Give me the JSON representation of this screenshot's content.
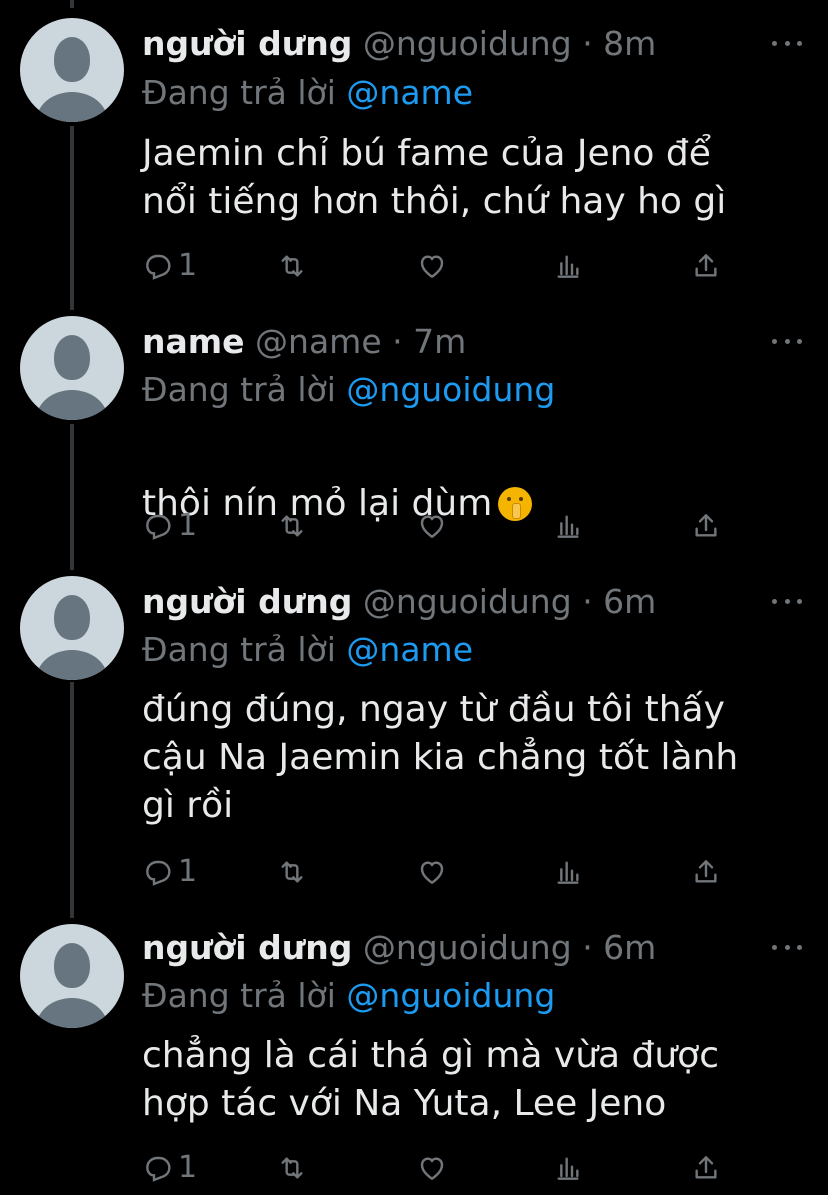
{
  "tweets": [
    {
      "display_name": "người dưng",
      "handle": "@nguoidung",
      "time": "· 8m",
      "reply_prefix": "Đang trả lời",
      "reply_to": "@name",
      "text": "Jaemin chỉ bú fame của Jeno để\nnổi tiếng hơn thôi, chứ hay ho gì",
      "reply_count": "1"
    },
    {
      "display_name": "name",
      "handle": "@name",
      "time": "· 7m",
      "reply_prefix": "Đang trả lời",
      "reply_to": "@nguoidung",
      "text": "thôi nín mỏ lại dùm",
      "emoji": "shushing-face",
      "reply_count": "1"
    },
    {
      "display_name": "người dưng",
      "handle": "@nguoidung",
      "time": "· 6m",
      "reply_prefix": "Đang trả lời",
      "reply_to": "@name",
      "text": "đúng đúng, ngay từ đầu tôi thấy\ncậu Na Jaemin kia chẳng tốt lành\ngì rồi",
      "reply_count": "1"
    },
    {
      "display_name": "người dưng",
      "handle": "@nguoidung",
      "time": "· 6m",
      "reply_prefix": "Đang trả lời",
      "reply_to": "@nguoidung",
      "text": "chẳng là cái thá gì mà vừa được\nhợp tác với Na Yuta, Lee Jeno",
      "reply_count": "1"
    }
  ],
  "icons": {
    "reply": "reply-icon",
    "retweet": "retweet-icon",
    "like": "heart-icon",
    "analytics": "analytics-icon",
    "share": "share-icon",
    "more": "more-icon"
  },
  "colors": {
    "background": "#000000",
    "text": "#e7e9ea",
    "secondary": "#71767b",
    "link": "#1d9bf0",
    "avatar_bg": "#ccd6dd",
    "avatar_fg": "#66757f"
  }
}
